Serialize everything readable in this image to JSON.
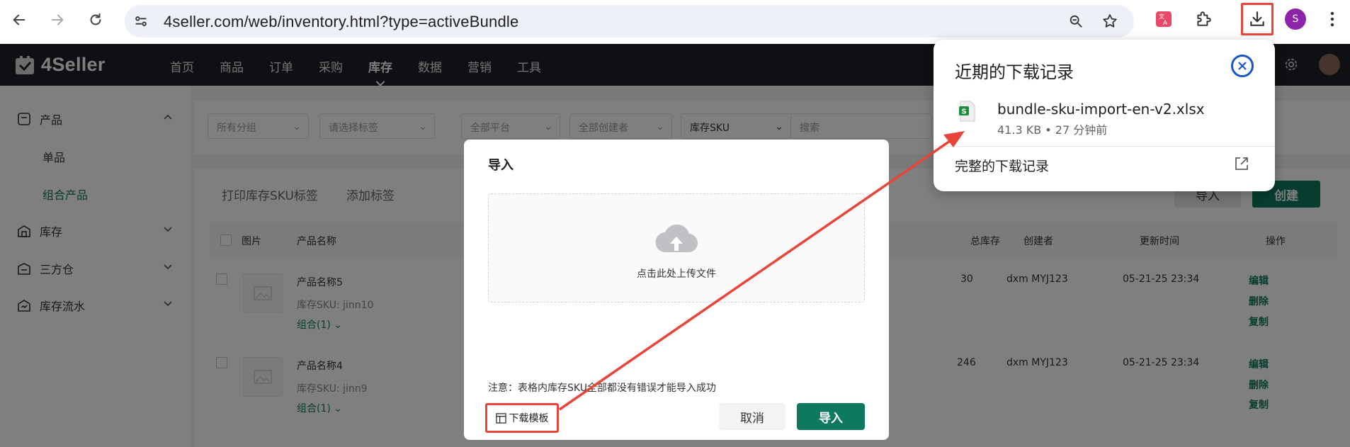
{
  "browser": {
    "url": "4seller.com/web/inventory.html?type=activeBundle",
    "profile_initial": "S",
    "icons": [
      "back-icon",
      "forward-icon",
      "reload-icon",
      "site-settings-icon",
      "zoom-icon",
      "bookmark-star-icon",
      "translate-extension-icon",
      "extensions-puzzle-icon",
      "download-icon",
      "profile-avatar-icon"
    ]
  },
  "header": {
    "logo_text": "4Seller",
    "nav": [
      "首页",
      "商品",
      "订单",
      "采购",
      "库存",
      "数据",
      "营销",
      "工具"
    ],
    "active_nav": "库存"
  },
  "sidebar": {
    "items": [
      {
        "label": "产品",
        "icon": "product-icon"
      },
      {
        "label": "单品",
        "sub": true
      },
      {
        "label": "组合产品",
        "sub": true,
        "active": true
      },
      {
        "label": "库存",
        "icon": "inventory-icon"
      },
      {
        "label": "三方仓",
        "icon": "warehouse-icon"
      },
      {
        "label": "库存流水",
        "icon": "flow-icon"
      }
    ]
  },
  "filters": {
    "group": "所有分组",
    "tag": "请选择标签",
    "platform": "全部平台",
    "creator": "全部创建者",
    "sku_type": "库存SKU",
    "search_placeholder": "搜索"
  },
  "toolbar": {
    "print_label": "打印库存SKU标签",
    "add_tag": "添加标签",
    "import": "导入",
    "create": "创建"
  },
  "table": {
    "headers": [
      "图片",
      "产品名称",
      "总库存",
      "创建者",
      "更新时间",
      "操作"
    ],
    "rows": [
      {
        "name": "产品名称5",
        "sku": "库存SKU: jinn10",
        "combo": "组合(1)",
        "stock": "30",
        "creator": "dxm MYJ123",
        "updated": "05-21-25 23:34",
        "actions": [
          "编辑",
          "删除",
          "复制"
        ]
      },
      {
        "name": "产品名称4",
        "sku": "库存SKU: jinn9",
        "combo": "组合(1)",
        "stock": "246",
        "creator": "dxm MYJ123",
        "updated": "05-21-25 23:34",
        "actions": [
          "编辑",
          "删除",
          "复制"
        ]
      }
    ]
  },
  "modal": {
    "title": "导入",
    "upload_text": "点击此处上传文件",
    "note": "注意：表格内库存SKU全部都没有错误才能导入成功",
    "download_template": "下载模板",
    "cancel": "取消",
    "import": "导入"
  },
  "downloads": {
    "title": "近期的下载记录",
    "file_name": "bundle-sku-import-en-v2.xlsx",
    "file_meta": "41.3 KB • 27 分钟前",
    "full_history": "完整的下载记录",
    "annotation_color": "#e8443a"
  }
}
